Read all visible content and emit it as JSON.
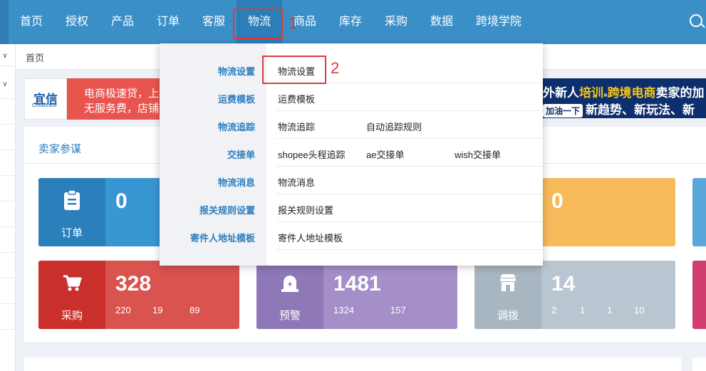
{
  "nav": {
    "items": [
      "首页",
      "授权",
      "产品",
      "订单",
      "客服",
      "物流",
      "商品",
      "库存",
      "采购",
      "数据",
      "跨境学院"
    ],
    "active": "物流",
    "annotation1": "1"
  },
  "breadcrumb": "首页",
  "banner": {
    "logo_main": "宜信",
    "logo_sub": "CreditEase",
    "left_line1": "电商极速贷，上",
    "left_line2": "无服务费，店铺",
    "right_line1_a": "外新人",
    "right_line1_b": "培训",
    "right_line1_c": "跨境电商",
    "right_line1_d": "卖家的加",
    "right_pill": "加油一下",
    "right_line2": "新趋势、新玩法、新"
  },
  "panel": {
    "title": "卖家参谋"
  },
  "cards": {
    "order": {
      "label": "订单",
      "value": "0"
    },
    "yellow": {
      "value": "0"
    },
    "purchase": {
      "label": "采购",
      "value": "328",
      "subs": [
        "220",
        "19",
        "89"
      ]
    },
    "warning": {
      "label": "预警",
      "value": "1481",
      "subs": [
        "1324",
        "157"
      ]
    },
    "transfer": {
      "label": "调拨",
      "value": "14",
      "subs": [
        "2",
        "1",
        "1",
        "10"
      ]
    }
  },
  "dropdown": {
    "annotation2": "2",
    "categories": [
      "物流设置",
      "运费模板",
      "物流追踪",
      "交接单",
      "物流消息",
      "报关规则设置",
      "寄件人地址模板"
    ],
    "rows": [
      [
        "物流设置"
      ],
      [
        "运费模板"
      ],
      [
        "物流追踪",
        "自动追踪规则"
      ],
      [
        "shopee头程追踪",
        "ae交接单",
        "wish交接单"
      ],
      [
        "物流消息"
      ],
      [
        "报关规则设置"
      ],
      [
        "寄件人地址模板"
      ]
    ]
  },
  "colors": {
    "nav_bg": "#3b8fc7",
    "order_card": "#3896d3",
    "purchase_card": "#d9534f",
    "warning_card": "#a48fc8",
    "transfer_card": "#b9c6d1",
    "yellow_card": "#f8bb5c",
    "annotation": "#e0393e"
  }
}
